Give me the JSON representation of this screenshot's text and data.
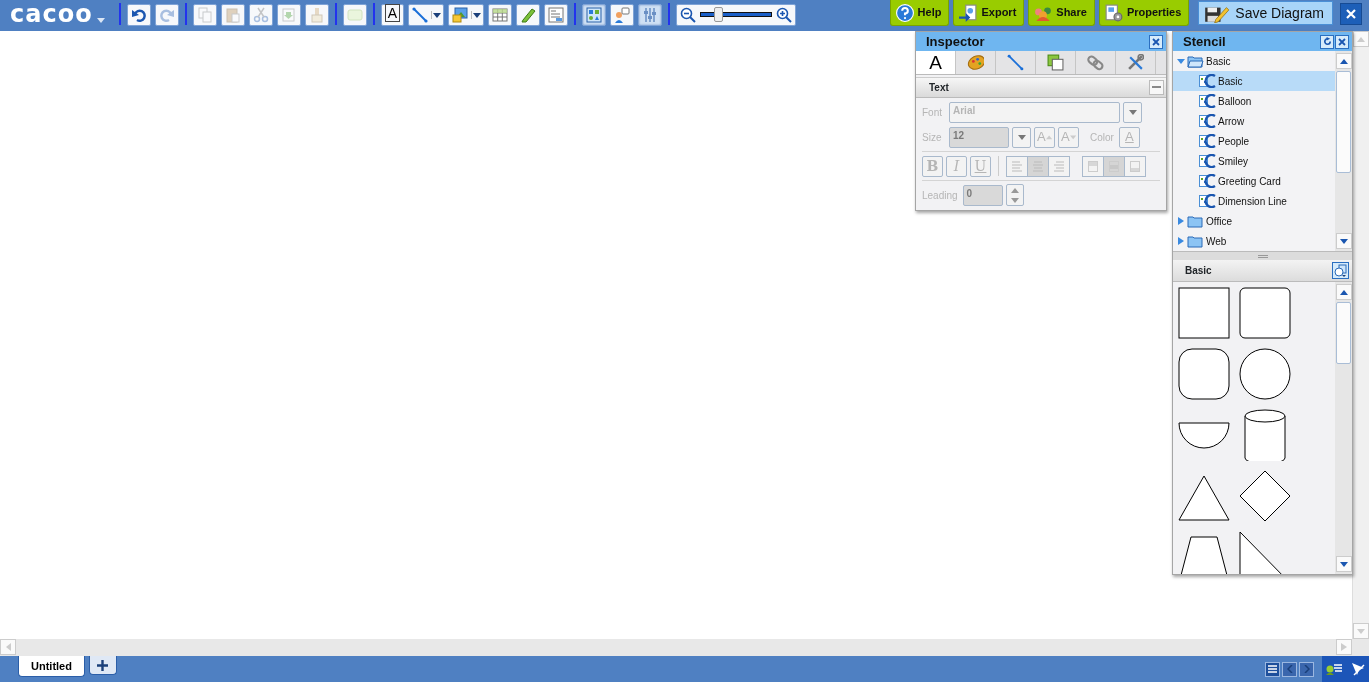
{
  "app": {
    "logo": "cacoo"
  },
  "toolbar": [
    [
      {
        "kind": "undo",
        "disabled": false
      },
      {
        "kind": "redo",
        "disabled": true
      }
    ],
    [
      {
        "kind": "copy",
        "disabled": true
      },
      {
        "kind": "paste",
        "disabled": true
      },
      {
        "kind": "cut",
        "disabled": true
      },
      {
        "kind": "duplicate",
        "disabled": true
      },
      {
        "kind": "format",
        "disabled": true
      }
    ],
    [
      {
        "kind": "shape",
        "disabled": true
      }
    ],
    [
      {
        "kind": "text",
        "label": "A",
        "disabled": false
      },
      {
        "kind": "line",
        "disabled": false,
        "dropdown": true
      },
      {
        "kind": "image",
        "disabled": false,
        "dropdown": true
      },
      {
        "kind": "table",
        "disabled": false
      },
      {
        "kind": "pencil",
        "disabled": false
      },
      {
        "kind": "form",
        "disabled": false
      }
    ],
    [
      {
        "kind": "stencil",
        "pressed": true
      },
      {
        "kind": "comment",
        "pressed": false
      },
      {
        "kind": "sliders",
        "pressed": true
      }
    ]
  ],
  "zoom": {
    "level": 0.25
  },
  "actions": [
    {
      "kind": "help",
      "label": "Help"
    },
    {
      "kind": "export",
      "label": "Export"
    },
    {
      "kind": "share",
      "label": "Share"
    },
    {
      "kind": "properties",
      "label": "Properties"
    }
  ],
  "save_button": {
    "label": "Save Diagram"
  },
  "inspector": {
    "title": "Inspector",
    "tabs": [
      {
        "kind": "text",
        "label": "A",
        "selected": true
      },
      {
        "kind": "style",
        "selected": false
      },
      {
        "kind": "line",
        "selected": false
      },
      {
        "kind": "shape",
        "selected": false
      },
      {
        "kind": "link",
        "selected": false
      },
      {
        "kind": "tools",
        "selected": false
      }
    ],
    "section": {
      "title": "Text",
      "disabled": true,
      "font": {
        "label": "Font",
        "value": "Arial"
      },
      "size": {
        "label": "Size",
        "value": "12"
      },
      "size_buttons": [
        {
          "kind": "grow",
          "label": "A"
        },
        {
          "kind": "shrink",
          "label": "A"
        }
      ],
      "color": {
        "label": "Color",
        "value": "A"
      },
      "style_buttons": [
        {
          "kind": "bold",
          "label": "B"
        },
        {
          "kind": "italic",
          "label": "I"
        },
        {
          "kind": "underline",
          "label": "U"
        }
      ],
      "align_buttons": [
        {
          "kind": "left",
          "selected": false
        },
        {
          "kind": "center",
          "selected": true
        },
        {
          "kind": "right",
          "selected": false
        }
      ],
      "valign_buttons": [
        {
          "kind": "top",
          "selected": false
        },
        {
          "kind": "middle",
          "selected": true
        },
        {
          "kind": "bottom",
          "selected": false
        }
      ],
      "leading": {
        "label": "Leading",
        "value": "0"
      }
    }
  },
  "stencil": {
    "title": "Stencil",
    "tree": [
      {
        "label": "Basic",
        "expanded": true,
        "children": [
          {
            "label": "Basic",
            "selected": true
          },
          {
            "label": "Balloon",
            "selected": false
          },
          {
            "label": "Arrow",
            "selected": false
          },
          {
            "label": "People",
            "selected": false
          },
          {
            "label": "Smiley",
            "selected": false
          },
          {
            "label": "Greeting Card",
            "selected": false
          },
          {
            "label": "Dimension Line",
            "selected": false
          }
        ]
      },
      {
        "label": "Office",
        "expanded": false
      },
      {
        "label": "Web",
        "expanded": false
      }
    ],
    "palette": {
      "title": "Basic",
      "shapes": [
        {
          "kind": "square"
        },
        {
          "kind": "rounded-square"
        },
        {
          "kind": "round-square"
        },
        {
          "kind": "circle"
        },
        {
          "kind": "half-circle"
        },
        {
          "kind": "cylinder"
        },
        {
          "kind": "triangle"
        },
        {
          "kind": "diamond"
        },
        {
          "kind": "trapezoid"
        },
        {
          "kind": "right-triangle"
        }
      ]
    }
  },
  "sheets": [
    {
      "label": "Untitled",
      "selected": true
    }
  ]
}
